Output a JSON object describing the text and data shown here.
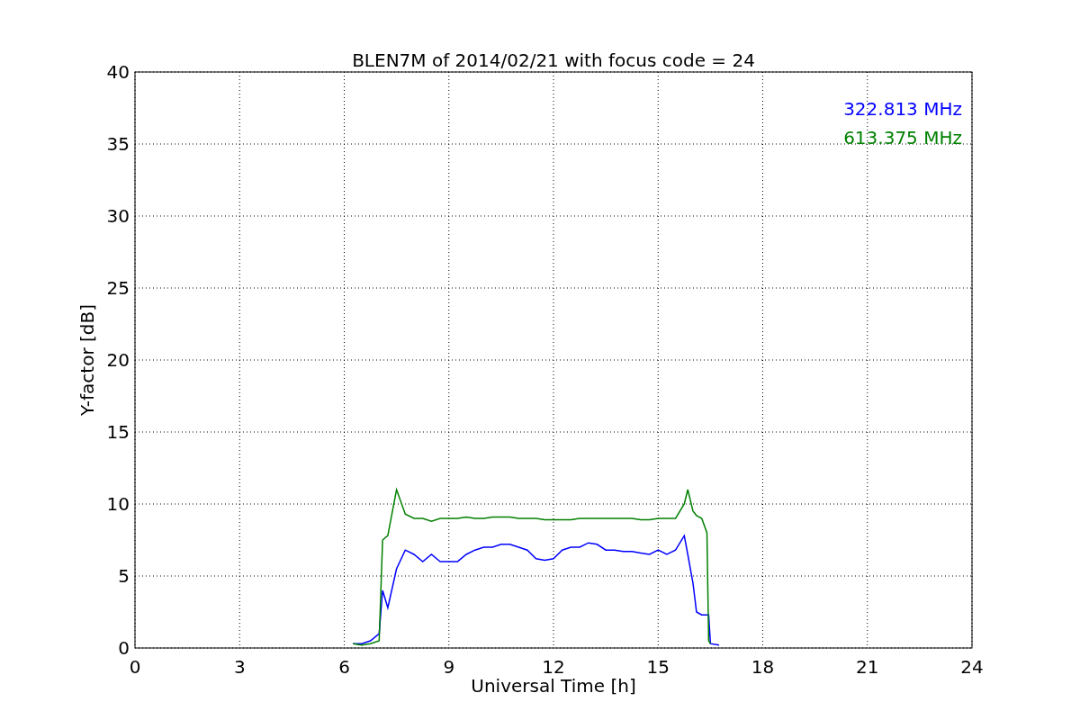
{
  "figure": {
    "chart_data": {
      "type": "line",
      "title": "BLEN7M of 2014/02/21 with focus code = 24",
      "xlabel": "Universal Time [h]",
      "ylabel": "Y-factor [dB]",
      "x": [
        6.25,
        6.5,
        6.75,
        7.0,
        7.1,
        7.25,
        7.5,
        7.75,
        8.0,
        8.25,
        8.5,
        8.75,
        9.0,
        9.25,
        9.5,
        9.75,
        10.0,
        10.25,
        10.5,
        10.75,
        11.0,
        11.25,
        11.5,
        11.75,
        12.0,
        12.25,
        12.5,
        12.75,
        13.0,
        13.25,
        13.5,
        13.75,
        14.0,
        14.25,
        14.5,
        14.75,
        15.0,
        15.25,
        15.5,
        15.75,
        15.85,
        16.0,
        16.1,
        16.25,
        16.4,
        16.45,
        16.5,
        16.75
      ],
      "series": [
        {
          "name": "322.813 MHz",
          "color": "#0000ff",
          "values": [
            0.3,
            0.3,
            0.5,
            1.0,
            4.0,
            2.8,
            5.5,
            6.8,
            6.5,
            6.0,
            6.5,
            6.0,
            6.0,
            6.0,
            6.5,
            6.8,
            7.0,
            7.0,
            7.2,
            7.2,
            7.0,
            6.8,
            6.2,
            6.1,
            6.2,
            6.8,
            7.0,
            7.0,
            7.3,
            7.2,
            6.8,
            6.8,
            6.7,
            6.7,
            6.6,
            6.5,
            6.8,
            6.5,
            6.8,
            7.8,
            6.5,
            4.5,
            2.5,
            2.3,
            2.3,
            2.3,
            0.3,
            0.2
          ]
        },
        {
          "name": "613.375 MHz",
          "color": "#008000",
          "values": [
            0.3,
            0.2,
            0.3,
            0.5,
            7.5,
            7.8,
            11.0,
            9.3,
            9.0,
            9.0,
            8.8,
            9.0,
            9.0,
            9.0,
            9.1,
            9.0,
            9.0,
            9.1,
            9.1,
            9.1,
            9.0,
            9.0,
            9.0,
            8.9,
            8.9,
            8.9,
            8.9,
            9.0,
            9.0,
            9.0,
            9.0,
            9.0,
            9.0,
            9.0,
            8.9,
            8.9,
            9.0,
            9.0,
            9.0,
            10.0,
            11.0,
            9.5,
            9.2,
            9.0,
            8.0,
            0.5,
            0.3,
            null
          ]
        }
      ],
      "grid": true,
      "xlim": [
        0,
        24
      ],
      "ylim": [
        0,
        40
      ],
      "xticks": [
        0,
        3,
        6,
        9,
        12,
        15,
        18,
        21,
        24
      ],
      "yticks": [
        0,
        5,
        10,
        15,
        20,
        25,
        30,
        35,
        40
      ]
    }
  }
}
